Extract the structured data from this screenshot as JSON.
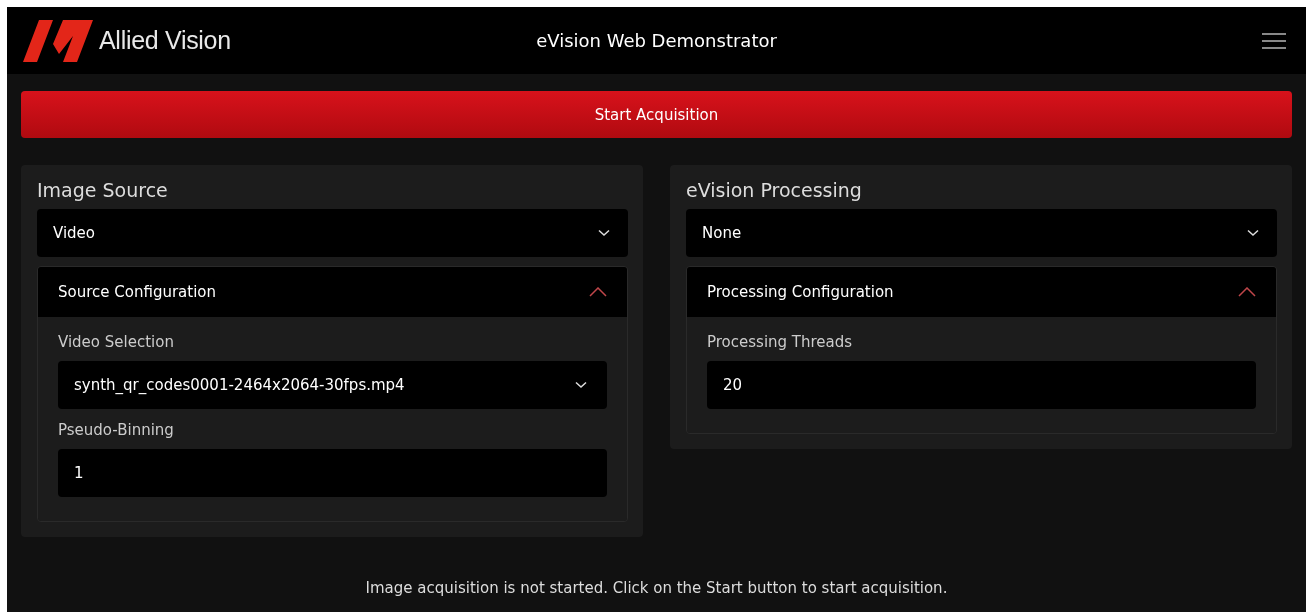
{
  "header": {
    "brand": "Allied Vision",
    "title": "eVision Web Demonstrator"
  },
  "start_button": "Start Acquisition",
  "panels": [
    {
      "title": "Image Source",
      "dropdown": "Video",
      "config": {
        "title": "Source Configuration",
        "expanded": true,
        "fields": [
          {
            "label": "Video Selection",
            "kind": "select",
            "value": "synth_qr_codes0001-2464x2064-30fps.mp4"
          },
          {
            "label": "Pseudo-Binning",
            "kind": "input",
            "value": "1"
          }
        ]
      }
    },
    {
      "title": "eVision Processing",
      "dropdown": "None",
      "config": {
        "title": "Processing Configuration",
        "expanded": true,
        "fields": [
          {
            "label": "Processing Threads",
            "kind": "input",
            "value": "20"
          }
        ]
      }
    }
  ],
  "status": "Image acquisition is not started. Click on the Start button to start acquisition."
}
